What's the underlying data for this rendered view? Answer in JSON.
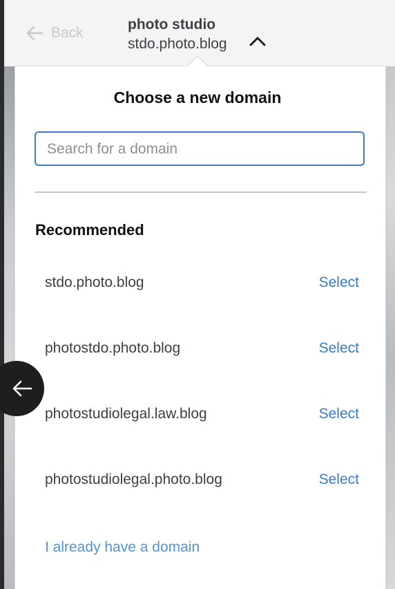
{
  "header": {
    "back_label": "Back",
    "site_title": "photo studio",
    "site_domain": "stdo.photo.blog"
  },
  "panel": {
    "heading": "Choose a new domain",
    "search": {
      "placeholder": "Search for a domain",
      "value": ""
    },
    "section_label": "Recommended",
    "domains": [
      {
        "name": "stdo.photo.blog",
        "action": "Select"
      },
      {
        "name": "photostdo.photo.blog",
        "action": "Select"
      },
      {
        "name": "photostudiolegal.law.blog",
        "action": "Select"
      },
      {
        "name": "photostudiolegal.photo.blog",
        "action": "Select"
      }
    ],
    "own_domain_link": "I already have a domain"
  },
  "colors": {
    "accent": "#3a7cc2",
    "link": "#5295d6",
    "input_border": "#3c7bc3"
  },
  "icons": {
    "header_back": "arrow-left-icon",
    "header_chevron": "chevron-up-icon",
    "float_back": "arrow-left-icon"
  }
}
